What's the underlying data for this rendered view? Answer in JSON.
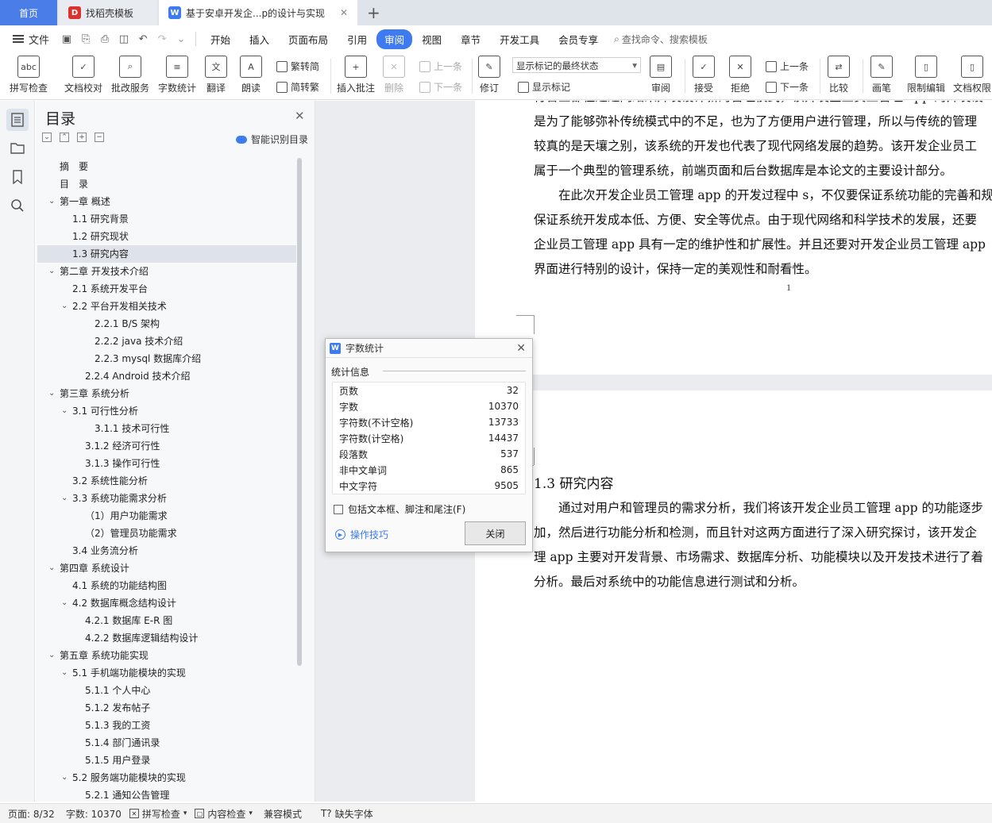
{
  "tabs": {
    "home": "首页",
    "template": "找稻壳模板",
    "document": "基于安卓开发企...p的设计与实现"
  },
  "menu": {
    "file": "文件",
    "items": [
      "开始",
      "插入",
      "页面布局",
      "引用",
      "审阅",
      "视图",
      "章节",
      "开发工具",
      "会员专享"
    ],
    "active": "审阅",
    "search": "查找命令、搜索模板"
  },
  "ribbon": {
    "spell_check": "拼写检查",
    "doc_proof": "文档校对",
    "batch_service": "批改服务",
    "word_count": "字数统计",
    "translate": "翻译",
    "read_aloud": "朗读",
    "to_traditional": "繁转简",
    "to_simplified": "简转繁",
    "insert_comment": "插入批注",
    "delete": "删除",
    "prev_comment": "上一条",
    "next_comment": "下一条",
    "revise": "修订",
    "markup_state": "显示标记的最终状态",
    "show_markup": "显示标记",
    "review": "审阅",
    "accept": "接受",
    "reject": "拒绝",
    "prev_change": "上一条",
    "next_change": "下一条",
    "compare": "比较",
    "ink": "画笔",
    "restrict_edit": "限制编辑",
    "doc_permission": "文档权限"
  },
  "toc": {
    "title": "目录",
    "smart": "智能识别目录",
    "items": [
      {
        "text": "摘　要",
        "level": 0,
        "caret": ""
      },
      {
        "text": "目　录",
        "level": 0,
        "caret": ""
      },
      {
        "text": "第一章  概述",
        "level": 0,
        "caret": "v"
      },
      {
        "text": "1.1  研究背景",
        "level": 1,
        "caret": ""
      },
      {
        "text": "1.2  研究现状",
        "level": 1,
        "caret": ""
      },
      {
        "text": "1.3  研究内容",
        "level": 1,
        "caret": "",
        "selected": true
      },
      {
        "text": "第二章  开发技术介绍",
        "level": 0,
        "caret": "v"
      },
      {
        "text": "2.1    系统开发平台",
        "level": 1,
        "caret": ""
      },
      {
        "text": "2.2  平台开发相关技术",
        "level": 1,
        "caret": "v"
      },
      {
        "text": "2.2.1    B/S 架构",
        "level": 2,
        "caret": ""
      },
      {
        "text": "2.2.2    java 技术介绍",
        "level": 2,
        "caret": ""
      },
      {
        "text": "2.2.3 mysql 数据库介绍",
        "level": 2,
        "caret": ""
      },
      {
        "text": "2.2.4 Android 技术介绍",
        "level": 3,
        "caret": ""
      },
      {
        "text": "第三章  系统分析",
        "level": 0,
        "caret": "v"
      },
      {
        "text": "3.1  可行性分析",
        "level": 1,
        "caret": "v"
      },
      {
        "text": "3.1.1    技术可行性",
        "level": 2,
        "caret": ""
      },
      {
        "text": "3.1.2  经济可行性",
        "level": 3,
        "caret": ""
      },
      {
        "text": "3.1.3  操作可行性",
        "level": 3,
        "caret": ""
      },
      {
        "text": "3.2  系统性能分析",
        "level": 1,
        "caret": ""
      },
      {
        "text": "3.3  系统功能需求分析",
        "level": 1,
        "caret": "v"
      },
      {
        "text": "（1）用户功能需求",
        "level": 3,
        "caret": ""
      },
      {
        "text": "（2）管理员功能需求",
        "level": 3,
        "caret": ""
      },
      {
        "text": "3.4  业务流分析",
        "level": 1,
        "caret": ""
      },
      {
        "text": "第四章  系统设计",
        "level": 0,
        "caret": "v"
      },
      {
        "text": "4.1  系统的功能结构图",
        "level": 1,
        "caret": ""
      },
      {
        "text": "4.2  数据库概念结构设计",
        "level": 1,
        "caret": "v"
      },
      {
        "text": "4.2.1    数据库 E-R 图",
        "level": 3,
        "caret": ""
      },
      {
        "text": "4.2.2  数据库逻辑结构设计",
        "level": 3,
        "caret": ""
      },
      {
        "text": "第五章  系统功能实现",
        "level": 0,
        "caret": "v"
      },
      {
        "text": "5.1  手机端功能模块的实现",
        "level": 1,
        "caret": "v"
      },
      {
        "text": "5.1.1 个人中心",
        "level": 3,
        "caret": ""
      },
      {
        "text": "5.1.2 发布帖子",
        "level": 3,
        "caret": ""
      },
      {
        "text": "5.1.3 我的工资",
        "level": 3,
        "caret": ""
      },
      {
        "text": "5.1.4 部门通讯录",
        "level": 3,
        "caret": ""
      },
      {
        "text": "5.1.5 用户登录",
        "level": 3,
        "caret": ""
      },
      {
        "text": "5.2 服务端功能模块的实现",
        "level": 1,
        "caret": "v"
      },
      {
        "text": "5.2.1 通知公告管理",
        "level": 3,
        "caret": ""
      }
    ]
  },
  "document": {
    "page1_lines": [
      "行合业都在通过网络来开发设计新的管理模式，该开发企业员工管理 app 的开发设",
      "是为了能够弥补传统模式中的不足，也为了方便用户进行管理，所以与传统的管理",
      "较真的是天壤之别，该系统的开发也代表了现代网络发展的趋势。该开发企业员工",
      "属于一个典型的管理系统，前端页面和后台数据库是本论文的主要设计部分。",
      "　　在此次开发企业员工管理 app 的开发过程中 s，不仅要保证系统功能的完善和规",
      "保证系统开发成本低、方便、安全等优点。由于现代网络和科学技术的发展，还要",
      "企业员工管理 app 具有一定的维护性和扩展性。并且还要对开发企业员工管理 app",
      "界面进行特别的设计，保持一定的美观性和耐看性。"
    ],
    "page_number": "1",
    "heading": "1.3  研究内容",
    "page2_lines": [
      "　　通过对用户和管理员的需求分析，我们将该开发企业员工管理 app 的功能逐步",
      "加，然后进行功能分析和检测，而且针对这两方面进行了深入研究探讨，该开发企",
      "理 app 主要对开发背景、市场需求、数据库分析、功能模块以及开发技术进行了着",
      "分析。最后对系统中的功能信息进行测试和分析。"
    ]
  },
  "dialog": {
    "title": "字数统计",
    "group": "统计信息",
    "rows": [
      {
        "label": "页数",
        "value": "32"
      },
      {
        "label": "字数",
        "value": "10370"
      },
      {
        "label": "字符数(不计空格)",
        "value": "13733"
      },
      {
        "label": "字符数(计空格)",
        "value": "14437"
      },
      {
        "label": "段落数",
        "value": "537"
      },
      {
        "label": "非中文单词",
        "value": "865"
      },
      {
        "label": "中文字符",
        "value": "9505"
      }
    ],
    "checkbox": "包括文本框、脚注和尾注(F)",
    "tips": "操作技巧",
    "close": "关闭"
  },
  "status": {
    "page": "页面: 8/32",
    "words": "字数: 10370",
    "spell": "拼写检查",
    "content": "内容检查",
    "compat": "兼容模式",
    "missing_font": "缺失字体"
  },
  "colors": {
    "accent": "#3e7bf0",
    "tab_home": "#4a7de8",
    "wps_red": "#d9322f"
  }
}
